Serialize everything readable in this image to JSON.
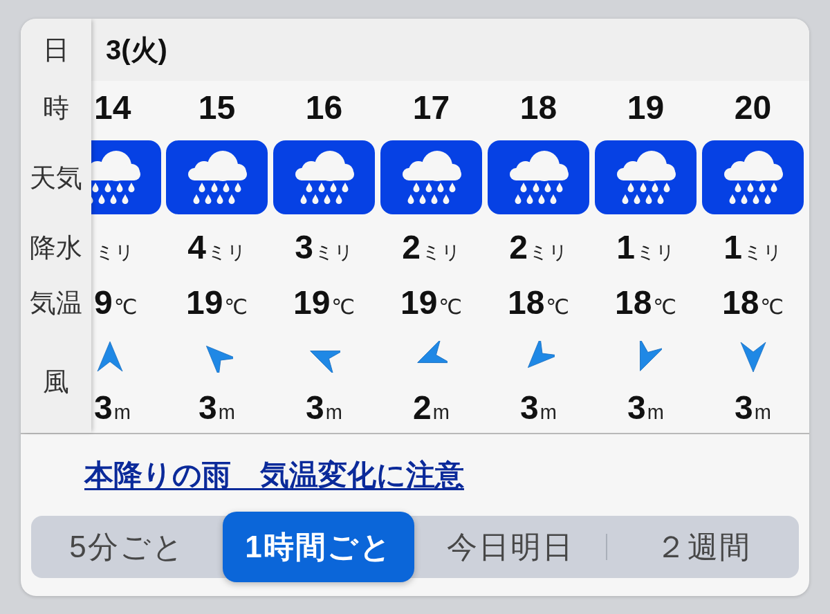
{
  "row_labels": [
    "日",
    "時",
    "天気",
    "降水",
    "気温",
    "風"
  ],
  "date": "3(火)",
  "hours": [
    {
      "kind": "partial",
      "hour": "14",
      "weather": {
        "kind": "rain"
      },
      "precipitation": {
        "unit": "ミリ"
      },
      "temperature": {
        "value": "9",
        "unit": "℃"
      },
      "wind": {
        "arrow": {
          "kind": "n"
        },
        "speed": "3",
        "unit": "m"
      }
    },
    {
      "kind": "full",
      "hour": "15",
      "weather": {
        "kind": "rain"
      },
      "precipitation": {
        "value": "4",
        "unit": "ミリ"
      },
      "temperature": {
        "value": "19",
        "unit": "℃"
      },
      "wind": {
        "arrow": {
          "kind": "nw"
        },
        "speed": "3",
        "unit": "m"
      }
    },
    {
      "kind": "full",
      "hour": "16",
      "weather": {
        "kind": "rain"
      },
      "precipitation": {
        "value": "3",
        "unit": "ミリ"
      },
      "temperature": {
        "value": "19",
        "unit": "℃"
      },
      "wind": {
        "arrow": {
          "kind": "wnw"
        },
        "speed": "3",
        "unit": "m"
      }
    },
    {
      "kind": "full",
      "hour": "17",
      "weather": {
        "kind": "rain"
      },
      "precipitation": {
        "value": "2",
        "unit": "ミリ"
      },
      "temperature": {
        "value": "19",
        "unit": "℃"
      },
      "wind": {
        "arrow": {
          "kind": "wsw"
        },
        "speed": "2",
        "unit": "m"
      }
    },
    {
      "kind": "full",
      "hour": "18",
      "weather": {
        "kind": "rain"
      },
      "precipitation": {
        "value": "2",
        "unit": "ミリ"
      },
      "temperature": {
        "value": "18",
        "unit": "℃"
      },
      "wind": {
        "arrow": {
          "kind": "sw"
        },
        "speed": "3",
        "unit": "m"
      }
    },
    {
      "kind": "full",
      "hour": "19",
      "weather": {
        "kind": "rain"
      },
      "precipitation": {
        "value": "1",
        "unit": "ミリ"
      },
      "temperature": {
        "value": "18",
        "unit": "℃"
      },
      "wind": {
        "arrow": {
          "kind": "ssw"
        },
        "speed": "3",
        "unit": "m"
      }
    },
    {
      "kind": "full",
      "hour": "20",
      "weather": {
        "kind": "rain"
      },
      "precipitation": {
        "value": "1",
        "unit": "ミリ"
      },
      "temperature": {
        "value": "18",
        "unit": "℃"
      },
      "wind": {
        "arrow": {
          "kind": "s"
        },
        "speed": "3",
        "unit": "m"
      }
    }
  ],
  "notice_link": "本降りの雨　気温変化に注意",
  "view_tabs": [
    {
      "label": "5分ごと",
      "selected": false
    },
    {
      "label": "1時間ごと",
      "selected": true
    },
    {
      "label": "今日明日",
      "selected": false
    },
    {
      "label": "２週間",
      "selected": false
    }
  ]
}
